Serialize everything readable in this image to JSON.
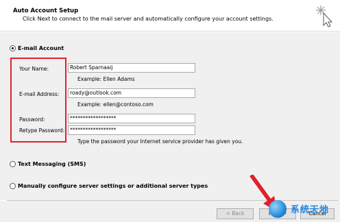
{
  "header": {
    "title": "Auto Account Setup",
    "subtitle": "Click Next to connect to the mail server and automatically configure your account settings."
  },
  "email_account": {
    "radio_label": "E-mail Account",
    "selected": true,
    "your_name_label": "Your Name:",
    "your_name_value": "Robert Sparnaaij",
    "your_name_hint": "Example: Ellen Adams",
    "email_label": "E-mail Address:",
    "email_value": "roady@outlook.com",
    "email_hint": "Example: ellen@contoso.com",
    "password_label": "Password:",
    "password_value": "******************",
    "retype_label": "Retype Password:",
    "retype_value": "******************",
    "password_hint": "Type the password your Internet service provider has given you."
  },
  "options": {
    "sms_label": "Text Messaging (SMS)",
    "manual_label": "Manually configure server settings or additional server types"
  },
  "footer": {
    "back_label": "< Back",
    "next_label": "Next >",
    "cancel_label": "Cancel"
  },
  "watermark": {
    "text": "系统天地"
  },
  "colors": {
    "highlight": "#e0202b",
    "panel_bg": "#f0f0f0",
    "header_bg": "#ffffff",
    "watermark": "#1e88e5"
  },
  "icons": [
    "wizard-sparkle-icon",
    "red-arrow-annotation",
    "watermark-globe-icon"
  ]
}
